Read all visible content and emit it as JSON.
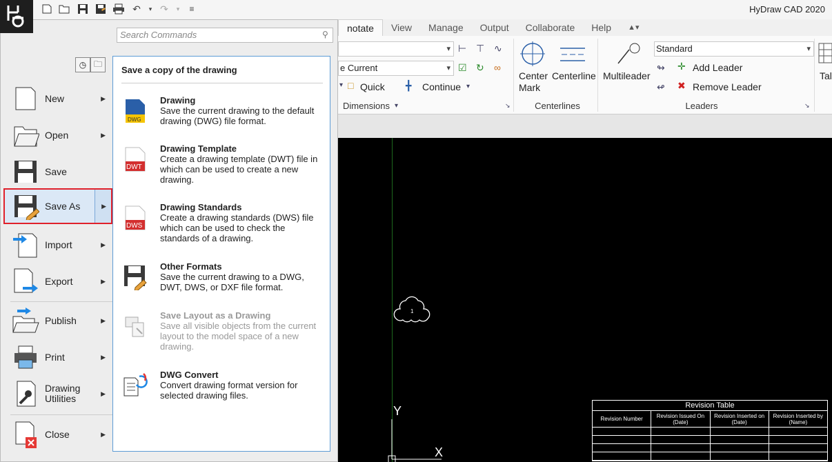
{
  "app": {
    "title": "HyDraw CAD 2020",
    "accent_color": "#1e1e1e",
    "selected_outline_color": "#e0202a"
  },
  "quick_access": [
    "new-icon",
    "open-icon",
    "save-icon",
    "save-as-icon",
    "print-icon",
    "undo-icon",
    "redo-icon",
    "customize-icon"
  ],
  "ribbon": {
    "tabs": [
      {
        "label": "notate",
        "active": true
      },
      {
        "label": "View"
      },
      {
        "label": "Manage"
      },
      {
        "label": "Output"
      },
      {
        "label": "Collaborate"
      },
      {
        "label": "Help"
      }
    ],
    "dim_style_value": "",
    "layer_value": "e Current",
    "quick_label": "Quick",
    "continue_label": "Continue",
    "dimensions_label": "Dimensions",
    "center_mark_label": "Center\nMark",
    "centerline_label": "Centerline",
    "centerlines_panel": "Centerlines",
    "multileader_label": "Multileader",
    "leader_style_value": "Standard",
    "add_leader_label": "Add Leader",
    "remove_leader_label": "Remove Leader",
    "leaders_panel": "Leaders",
    "table_label": "Tal"
  },
  "app_menu": {
    "search_placeholder": "Search Commands",
    "items": [
      {
        "label": "New",
        "icon": "new-document-icon",
        "has_arrow": true
      },
      {
        "label": "Open",
        "icon": "open-folder-icon",
        "has_arrow": true
      },
      {
        "label": "Save",
        "icon": "save-disk-icon",
        "has_arrow": false
      },
      {
        "label": "Save As",
        "icon": "save-as-icon",
        "has_arrow": true,
        "selected": true
      },
      {
        "label": "Import",
        "icon": "import-icon",
        "has_arrow": true
      },
      {
        "label": "Export",
        "icon": "export-icon",
        "has_arrow": true
      },
      {
        "label": "Publish",
        "icon": "publish-icon",
        "has_arrow": true
      },
      {
        "label": "Print",
        "icon": "printer-icon",
        "has_arrow": true
      },
      {
        "label": "Drawing\nUtilities",
        "icon": "utilities-wrench-icon",
        "has_arrow": true
      },
      {
        "label": "Close",
        "icon": "close-document-icon",
        "has_arrow": true
      }
    ],
    "submenu": {
      "title": "Save a copy of the drawing",
      "items": [
        {
          "name": "Drawing",
          "desc": "Save the current drawing to the default drawing (DWG) file format.",
          "icon": "dwg-file-icon",
          "badge": "DWG"
        },
        {
          "name": "Drawing Template",
          "desc": "Create a drawing template (DWT) file in which can be used to create a new drawing.",
          "icon": "dwt-file-icon",
          "badge": "DWT"
        },
        {
          "name": "Drawing Standards",
          "desc": "Create a drawing standards (DWS) file which can be used to check the standards of a drawing.",
          "icon": "dws-file-icon",
          "badge": "DWS"
        },
        {
          "name": "Other Formats",
          "desc": "Save the current drawing to a DWG, DWT, DWS, or DXF file format.",
          "icon": "save-other-formats-icon"
        },
        {
          "name": "Save Layout as a Drawing",
          "desc": "Save all visible objects from the current layout to the model space of a new drawing.",
          "icon": "save-layout-icon",
          "disabled": true
        },
        {
          "name": "DWG Convert",
          "desc": "Convert drawing format version for selected drawing files.",
          "icon": "dwg-convert-icon"
        }
      ]
    }
  },
  "canvas": {
    "cloud_label": "1",
    "y_axis": "Y",
    "x_axis": "X",
    "revision_table": {
      "title": "Revision Table",
      "headers": [
        "Revision Number",
        "Revision Issued On\n(Date)",
        "Revision Inserted on\n(Date)",
        "Revision Inserted by\n(Name)"
      ],
      "empty_rows": 4
    }
  }
}
